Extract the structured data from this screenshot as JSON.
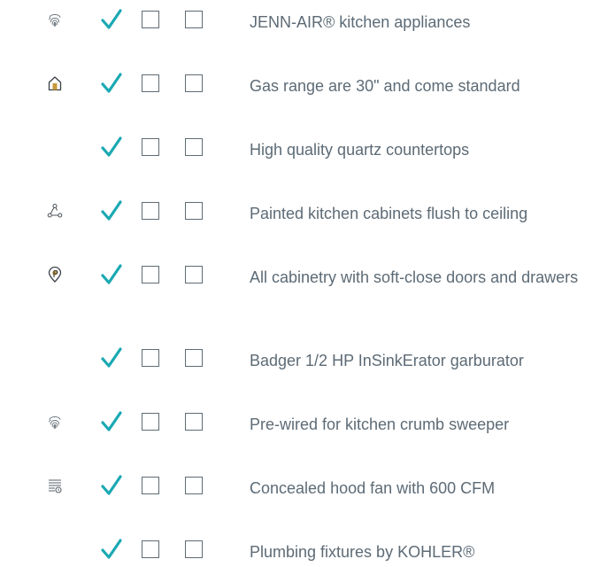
{
  "colors": {
    "check": "#1aa9b3",
    "text": "#5d6b76",
    "icon": "#5e6670",
    "box_border": "#5f6b73"
  },
  "items": [
    {
      "label": "JENN-AIR® kitchen appliances",
      "icon": "fingerprint-icon",
      "checked": true
    },
    {
      "label": "Gas range are 30\" and come standard",
      "icon": "home-icon",
      "checked": true
    },
    {
      "label": "High quality quartz countertops",
      "icon": "",
      "checked": true
    },
    {
      "label": "Painted kitchen cabinets flush to ceiling",
      "icon": "network-nodes-icon",
      "checked": true
    },
    {
      "label": "All cabinetry with soft-close doors and drawers",
      "icon": "location-pin-icon",
      "checked": true
    },
    {
      "label": "Badger 1/2 HP InSinkErator garburator",
      "icon": "",
      "checked": true
    },
    {
      "label": "Pre-wired for kitchen crumb sweeper",
      "icon": "fingerprint-icon",
      "checked": true
    },
    {
      "label": "Concealed hood fan with 600 CFM",
      "icon": "list-clock-icon",
      "checked": true
    },
    {
      "label": "Plumbing fixtures by KOHLER®",
      "icon": "",
      "checked": true
    }
  ]
}
